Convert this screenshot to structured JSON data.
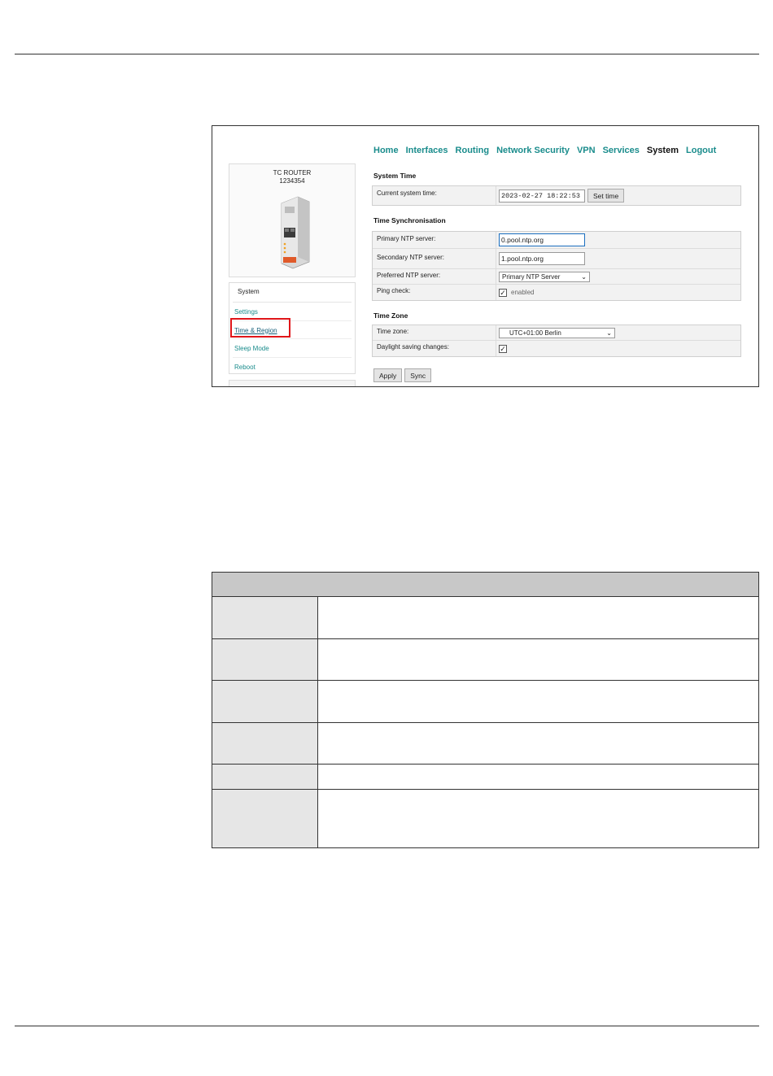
{
  "router": {
    "model": "TC ROUTER",
    "serial": "1234354"
  },
  "nav": [
    "Home",
    "Interfaces",
    "Routing",
    "Network Security",
    "VPN",
    "Services",
    "System",
    "Logout"
  ],
  "nav_current": "System",
  "sidebar": {
    "heading": "System",
    "items": [
      "Settings",
      "Time & Region",
      "Sleep Mode",
      "Reboot"
    ],
    "active": "Time & Region"
  },
  "system_time": {
    "title": "System Time",
    "current_label": "Current system time:",
    "current_value": "2023-02-27 18:22:53",
    "set_button": "Set time"
  },
  "time_sync": {
    "title": "Time Synchronisation",
    "primary_label": "Primary NTP server:",
    "primary_value": "0.pool.ntp.org",
    "secondary_label": "Secondary NTP server:",
    "secondary_value": "1.pool.ntp.org",
    "preferred_label": "Preferred NTP server:",
    "preferred_value": "Primary NTP Server",
    "ping_label": "Ping check:",
    "ping_value": "enabled",
    "ping_checked": true
  },
  "time_zone": {
    "title": "Time Zone",
    "zone_label": "Time zone:",
    "zone_value": "UTC+01:00 Berlin",
    "dst_label": "Daylight saving changes:",
    "dst_checked": true
  },
  "actions": {
    "apply": "Apply",
    "sync": "Sync"
  },
  "icons": {
    "checkbox": "✓",
    "dropdown": "⌄"
  },
  "colors": {
    "link": "#1a8c8c",
    "highlight": "#e0161a"
  }
}
